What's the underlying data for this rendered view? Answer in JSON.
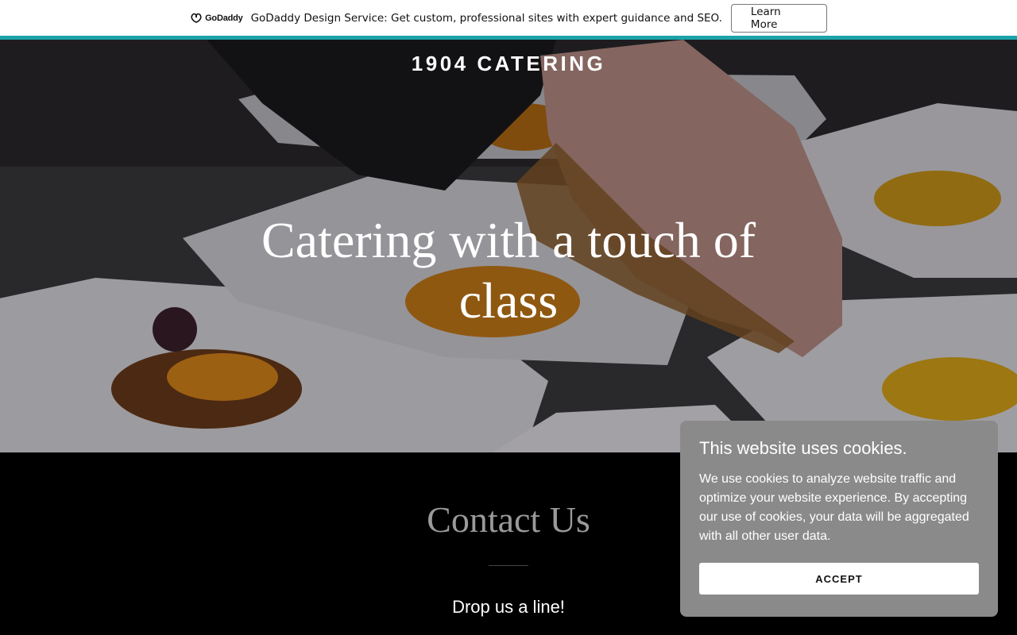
{
  "promo": {
    "logo_text": "GoDaddy",
    "message": "GoDaddy Design Service: Get custom, professional sites with expert guidance and SEO.",
    "button_label": "Learn More",
    "accent_color": "#1ba3a8"
  },
  "hero": {
    "brand": "1904 CATERING",
    "title": "Catering with a touch of class"
  },
  "contact": {
    "title": "Contact Us",
    "subtitle": "Drop us a line!"
  },
  "cookie": {
    "title": "This website uses cookies.",
    "body": "We use cookies to analyze website traffic and optimize your website experience. By accepting our use of cookies, your data will be aggregated with all other user data.",
    "accept_label": "ACCEPT",
    "background_color": "#8a8a8a"
  }
}
